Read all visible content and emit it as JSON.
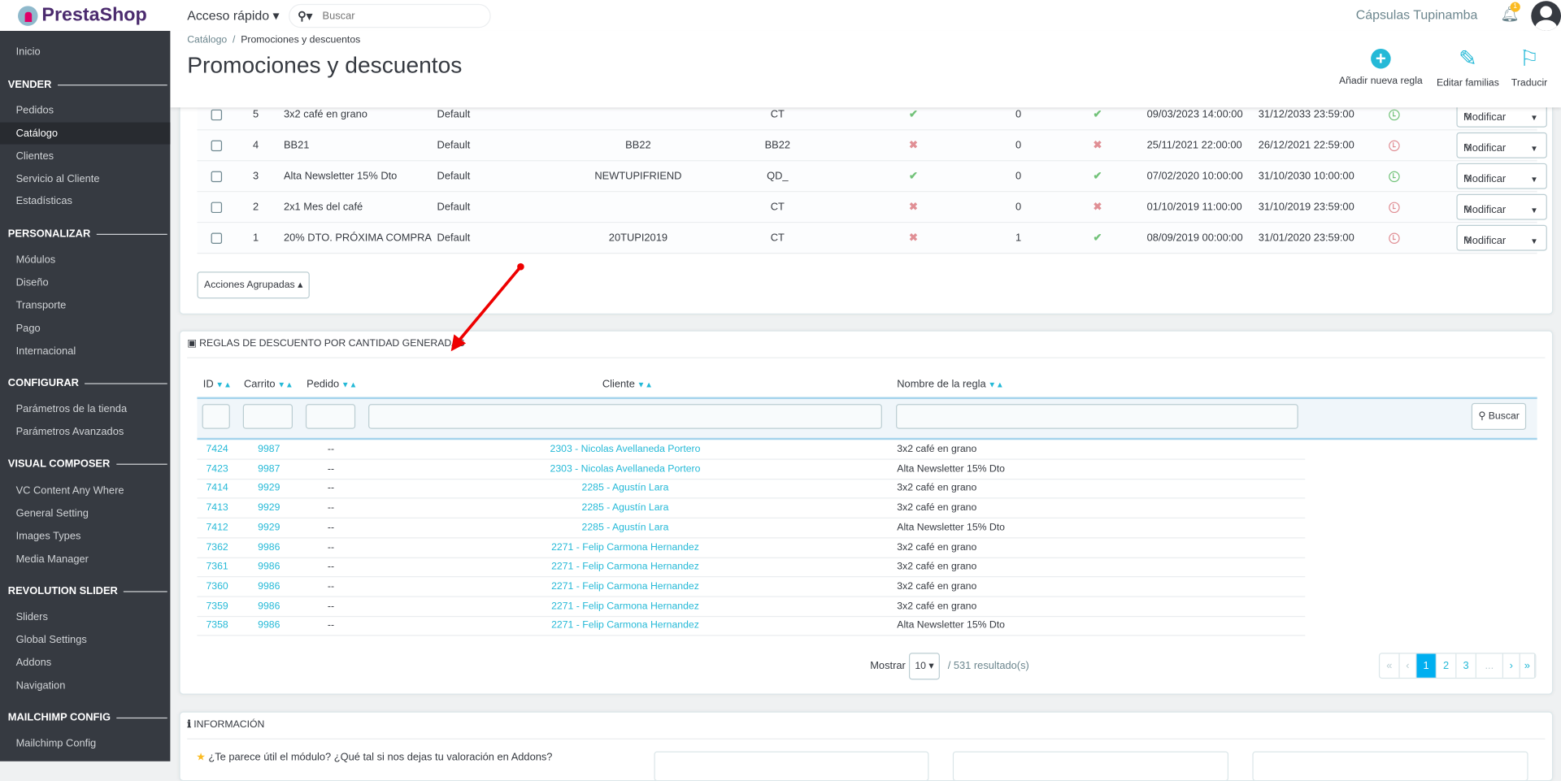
{
  "header": {
    "logo": "PrestaShop",
    "quick_access": "Acceso rápido ▾",
    "search_placeholder": "Buscar",
    "shop_name": "Cápsulas Tupinamba",
    "notifications": "1"
  },
  "sidebar": {
    "items": [
      {
        "type": "item",
        "label": "Inicio"
      },
      {
        "type": "section",
        "label": "VENDER"
      },
      {
        "type": "item",
        "label": "Pedidos"
      },
      {
        "type": "item",
        "label": "Catálogo",
        "active": true
      },
      {
        "type": "item",
        "label": "Clientes"
      },
      {
        "type": "item",
        "label": "Servicio al Cliente"
      },
      {
        "type": "item",
        "label": "Estadísticas"
      },
      {
        "type": "section",
        "label": "PERSONALIZAR"
      },
      {
        "type": "item",
        "label": "Módulos"
      },
      {
        "type": "item",
        "label": "Diseño"
      },
      {
        "type": "item",
        "label": "Transporte"
      },
      {
        "type": "item",
        "label": "Pago"
      },
      {
        "type": "item",
        "label": "Internacional"
      },
      {
        "type": "section",
        "label": "CONFIGURAR"
      },
      {
        "type": "item",
        "label": "Parámetros de la tienda"
      },
      {
        "type": "item",
        "label": "Parámetros Avanzados"
      },
      {
        "type": "section",
        "label": "VISUAL COMPOSER"
      },
      {
        "type": "item",
        "label": "VC Content Any Where"
      },
      {
        "type": "item",
        "label": "General Setting"
      },
      {
        "type": "item",
        "label": "Images Types"
      },
      {
        "type": "item",
        "label": "Media Manager"
      },
      {
        "type": "section",
        "label": "REVOLUTION SLIDER"
      },
      {
        "type": "item",
        "label": "Sliders"
      },
      {
        "type": "item",
        "label": "Global Settings"
      },
      {
        "type": "item",
        "label": "Addons"
      },
      {
        "type": "item",
        "label": "Navigation"
      },
      {
        "type": "section",
        "label": "MAILCHIMP CONFIG"
      },
      {
        "type": "item",
        "label": "Mailchimp Config"
      }
    ]
  },
  "page": {
    "breadcrumb": [
      "Catálogo",
      "Promociones y descuentos"
    ],
    "breadcrumb_sep": "/",
    "title": "Promociones y descuentos",
    "toolbar": [
      {
        "label": "Añadir nueva regla",
        "icon": "plus-circle-icon"
      },
      {
        "label": "Editar familias",
        "icon": "edit-icon"
      },
      {
        "label": "Traducir",
        "icon": "flag-icon"
      }
    ]
  },
  "rules": {
    "edit_label": "Modificar",
    "bulk_label": "Acciones Agrupadas ▴",
    "rows": [
      {
        "id": "5",
        "name": "3x2 café en grano",
        "shop": "Default",
        "code": "",
        "prefix": "CT",
        "active": true,
        "used": "0",
        "valid": true,
        "from": "09/03/2023 14:00:00",
        "to": "31/12/2033 23:59:00",
        "status": "green"
      },
      {
        "id": "4",
        "name": "BB21",
        "shop": "Default",
        "code": "BB22",
        "prefix": "BB22",
        "active": false,
        "used": "0",
        "valid": false,
        "from": "25/11/2021 22:00:00",
        "to": "26/12/2021 22:59:00",
        "status": "red"
      },
      {
        "id": "3",
        "name": "Alta Newsletter 15% Dto",
        "shop": "Default",
        "code": "NEWTUPIFRIEND",
        "prefix": "QD_",
        "active": true,
        "used": "0",
        "valid": true,
        "from": "07/02/2020 10:00:00",
        "to": "31/10/2030 10:00:00",
        "status": "green"
      },
      {
        "id": "2",
        "name": "2x1 Mes del café",
        "shop": "Default",
        "code": "",
        "prefix": "CT",
        "active": false,
        "used": "0",
        "valid": false,
        "from": "01/10/2019 11:00:00",
        "to": "31/10/2019 23:59:00",
        "status": "red"
      },
      {
        "id": "1",
        "name": "20% DTO. PRÓXIMA COMPRA",
        "shop": "Default",
        "code": "20TUPI2019",
        "prefix": "CT",
        "active": false,
        "used": "1",
        "valid": true,
        "from": "08/09/2019 00:00:00",
        "to": "31/01/2020 23:59:00",
        "status": "red"
      }
    ]
  },
  "generated": {
    "title": "REGLAS DE DESCUENTO POR CANTIDAD GENERADAS",
    "columns": [
      "ID",
      "Carrito",
      "Pedido",
      "Cliente",
      "Nombre de la regla"
    ],
    "search_label": "Buscar",
    "rows": [
      [
        "7424",
        "9987",
        "--",
        "2303 - Nicolas Avellaneda Portero",
        "3x2 café en grano"
      ],
      [
        "7423",
        "9987",
        "--",
        "2303 - Nicolas Avellaneda Portero",
        "Alta Newsletter 15% Dto"
      ],
      [
        "7414",
        "9929",
        "--",
        "2285 - Agustín Lara",
        "3x2 café en grano"
      ],
      [
        "7413",
        "9929",
        "--",
        "2285 - Agustín Lara",
        "3x2 café en grano"
      ],
      [
        "7412",
        "9929",
        "--",
        "2285 - Agustín Lara",
        "Alta Newsletter 15% Dto"
      ],
      [
        "7362",
        "9986",
        "--",
        "2271 - Felip Carmona Hernandez",
        "3x2 café en grano"
      ],
      [
        "7361",
        "9986",
        "--",
        "2271 - Felip Carmona Hernandez",
        "3x2 café en grano"
      ],
      [
        "7360",
        "9986",
        "--",
        "2271 - Felip Carmona Hernandez",
        "3x2 café en grano"
      ],
      [
        "7359",
        "9986",
        "--",
        "2271 - Felip Carmona Hernandez",
        "3x2 café en grano"
      ],
      [
        "7358",
        "9986",
        "--",
        "2271 - Felip Carmona Hernandez",
        "Alta Newsletter 15% Dto"
      ]
    ],
    "show_label": "Mostrar",
    "per_page": "10",
    "results": "/ 531 resultado(s)",
    "pages": [
      "«",
      "‹",
      "1",
      "2",
      "3",
      "...",
      "›",
      "»"
    ],
    "current_page": "1"
  },
  "info": {
    "title": "INFORMACIÓN",
    "text": "¿Te parece útil el módulo? ¿Qué tal si nos dejas tu valoración en Addons?"
  },
  "colors": {
    "accent": "#25b9d7",
    "success": "#72c279",
    "danger": "#e08f95",
    "sidebar": "#363a41"
  }
}
